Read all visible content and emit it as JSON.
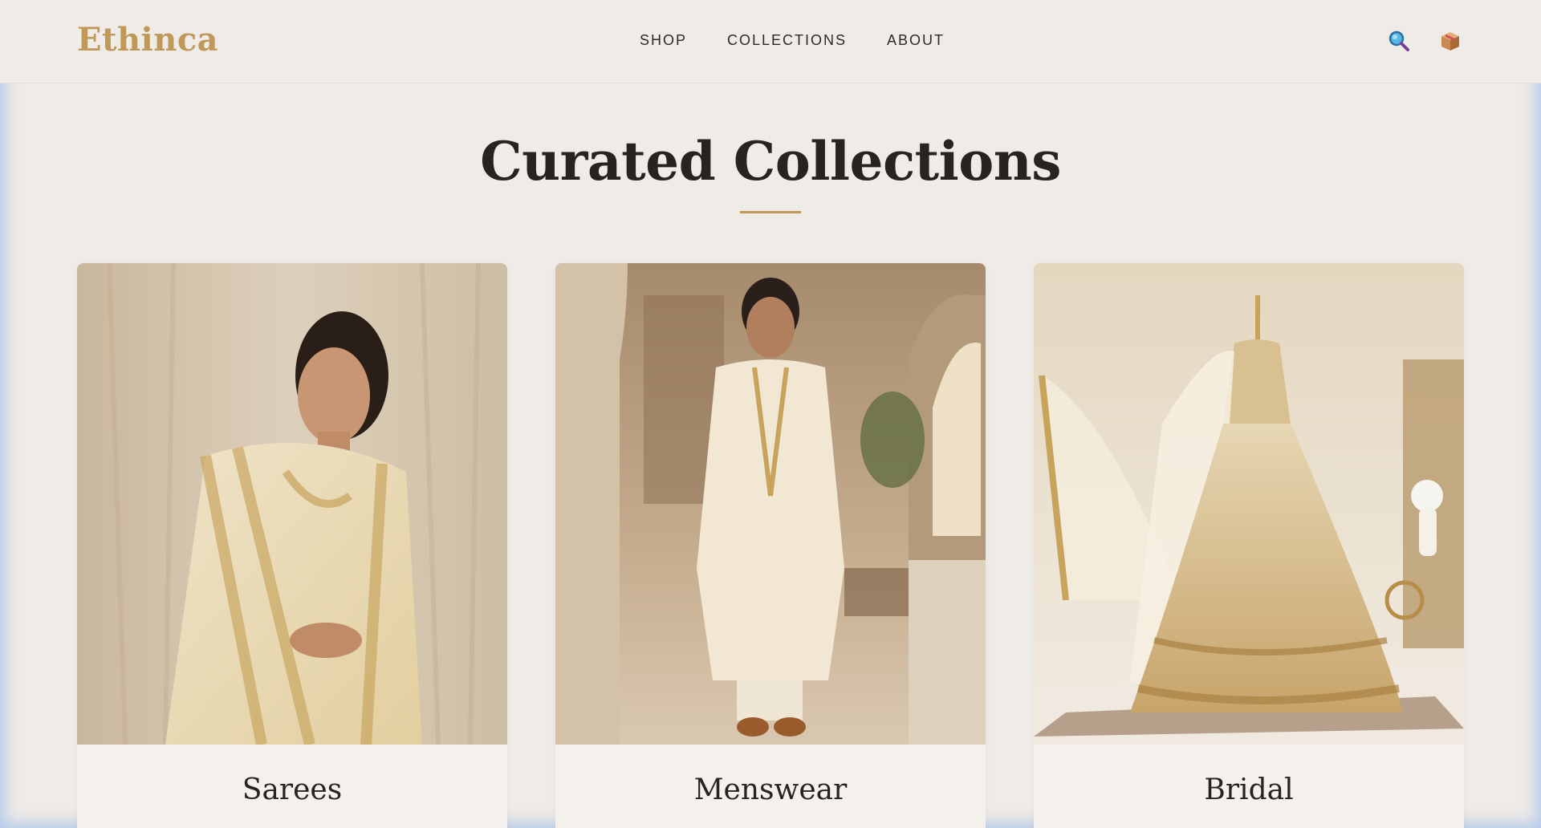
{
  "header": {
    "logo": "Ethinca",
    "nav": [
      "SHOP",
      "COLLECTIONS",
      "ABOUT"
    ],
    "icons": [
      "search-icon",
      "cart-box-icon"
    ]
  },
  "main": {
    "title": "Curated Collections",
    "collections": [
      {
        "label": "Sarees",
        "image": "woman-in-cream-gold-saree"
      },
      {
        "label": "Menswear",
        "image": "man-in-cream-kurta"
      },
      {
        "label": "Bridal",
        "image": "bridal-lehenga-on-mannequin"
      }
    ]
  },
  "colors": {
    "accent": "#c0985a",
    "background": "#efebe7",
    "text": "#262322"
  }
}
